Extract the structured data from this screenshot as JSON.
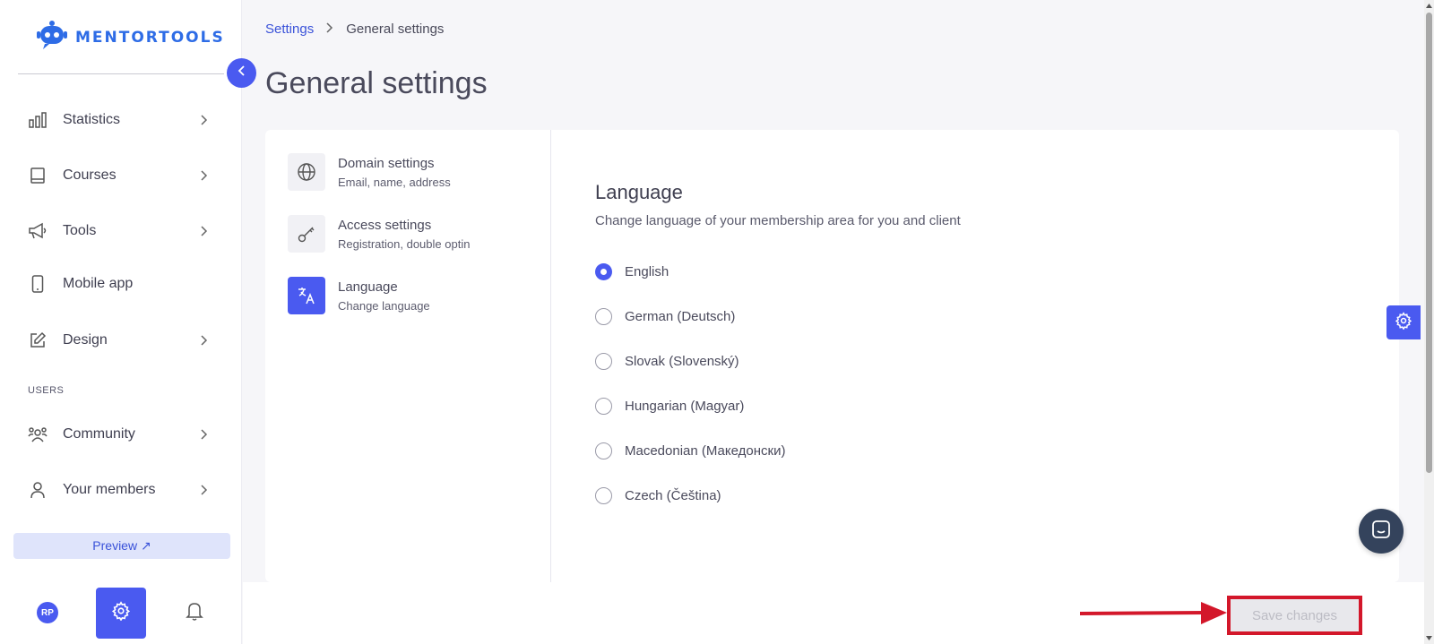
{
  "brand": {
    "name": "MENTORTOOLS",
    "color": "#2e6ce6"
  },
  "colors": {
    "accent": "#4a5af0",
    "highlight": "#d3172a"
  },
  "sidebar": {
    "items": [
      {
        "label": "Statistics",
        "icon": "bar-chart-icon",
        "has_submenu": true
      },
      {
        "label": "Courses",
        "icon": "book-icon",
        "has_submenu": true
      },
      {
        "label": "Tools",
        "icon": "megaphone-icon",
        "has_submenu": true
      },
      {
        "label": "Mobile app",
        "icon": "phone-icon",
        "has_submenu": false
      },
      {
        "label": "Design",
        "icon": "pencil-icon",
        "has_submenu": true
      }
    ],
    "users_section_label": "USERS",
    "user_items": [
      {
        "label": "Community",
        "icon": "community-icon",
        "has_submenu": true
      },
      {
        "label": "Your members",
        "icon": "person-icon",
        "has_submenu": true
      }
    ],
    "preview_label": "Preview ↗",
    "avatar_initials": "RP"
  },
  "breadcrumb": {
    "parent": "Settings",
    "current": "General settings"
  },
  "page_title": "General settings",
  "settings_menu": [
    {
      "title": "Domain settings",
      "subtitle": "Email, name, address",
      "icon": "globe-icon",
      "active": false
    },
    {
      "title": "Access settings",
      "subtitle": "Registration, double optin",
      "icon": "key-icon",
      "active": false
    },
    {
      "title": "Language",
      "subtitle": "Change language",
      "icon": "translate-icon",
      "active": true
    }
  ],
  "language": {
    "title": "Language",
    "description": "Change language of your membership area for you and client",
    "options": [
      {
        "label": "English",
        "selected": true
      },
      {
        "label": "German (Deutsch)",
        "selected": false
      },
      {
        "label": "Slovak (Slovenský)",
        "selected": false
      },
      {
        "label": "Hungarian (Magyar)",
        "selected": false
      },
      {
        "label": "Macedonian (Македонски)",
        "selected": false
      },
      {
        "label": "Czech (Čeština)",
        "selected": false
      }
    ]
  },
  "footer": {
    "save_label": "Save changes"
  }
}
